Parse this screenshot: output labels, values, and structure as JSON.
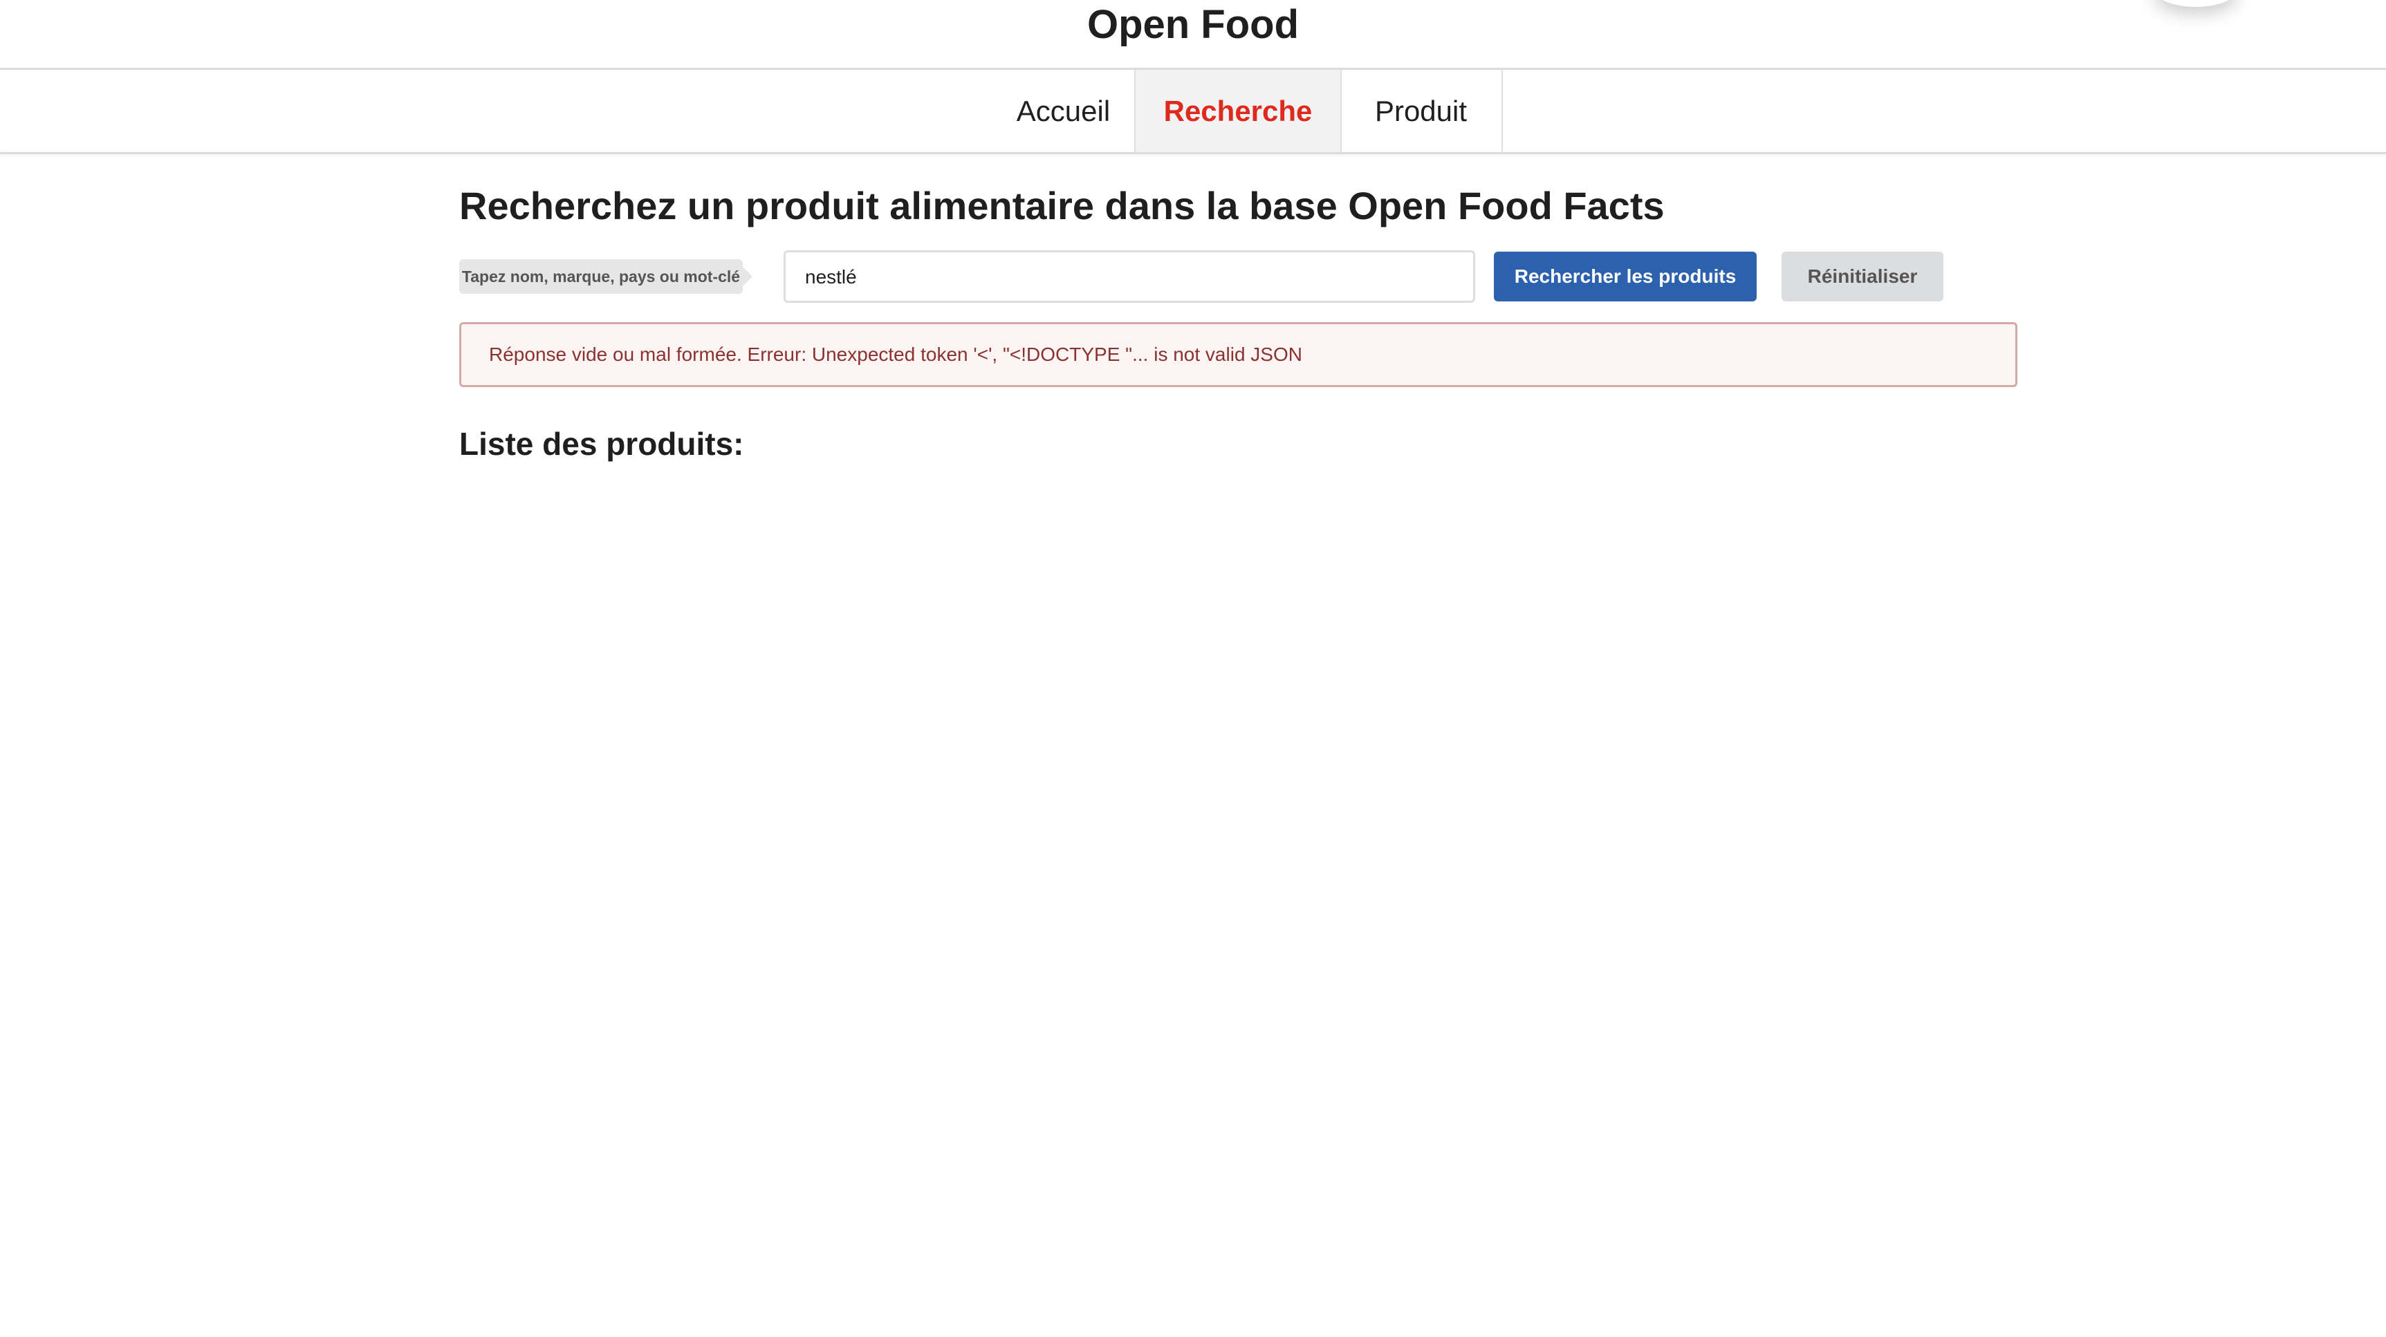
{
  "header": {
    "title": "Open Food"
  },
  "nav": {
    "tabs": [
      {
        "label": "Accueil"
      },
      {
        "label": "Recherche"
      },
      {
        "label": "Produit"
      }
    ]
  },
  "main": {
    "heading": "Recherchez un produit alimentaire dans la base Open Food Facts",
    "search_label": "Tapez nom, marque, pays ou mot-clé",
    "search_value": "nestlé",
    "search_button": "Rechercher les produits",
    "reset_button": "Réinitialiser",
    "error": "Réponse vide ou mal formée. Erreur: Unexpected token '<', \"<!DOCTYPE \"... is not valid JSON",
    "list_heading": "Liste des produits:"
  },
  "colors": {
    "accent": "#e0291e",
    "primary": "#2c62ad",
    "error_text": "#8a3230",
    "error_bg": "#fdf4f4"
  }
}
